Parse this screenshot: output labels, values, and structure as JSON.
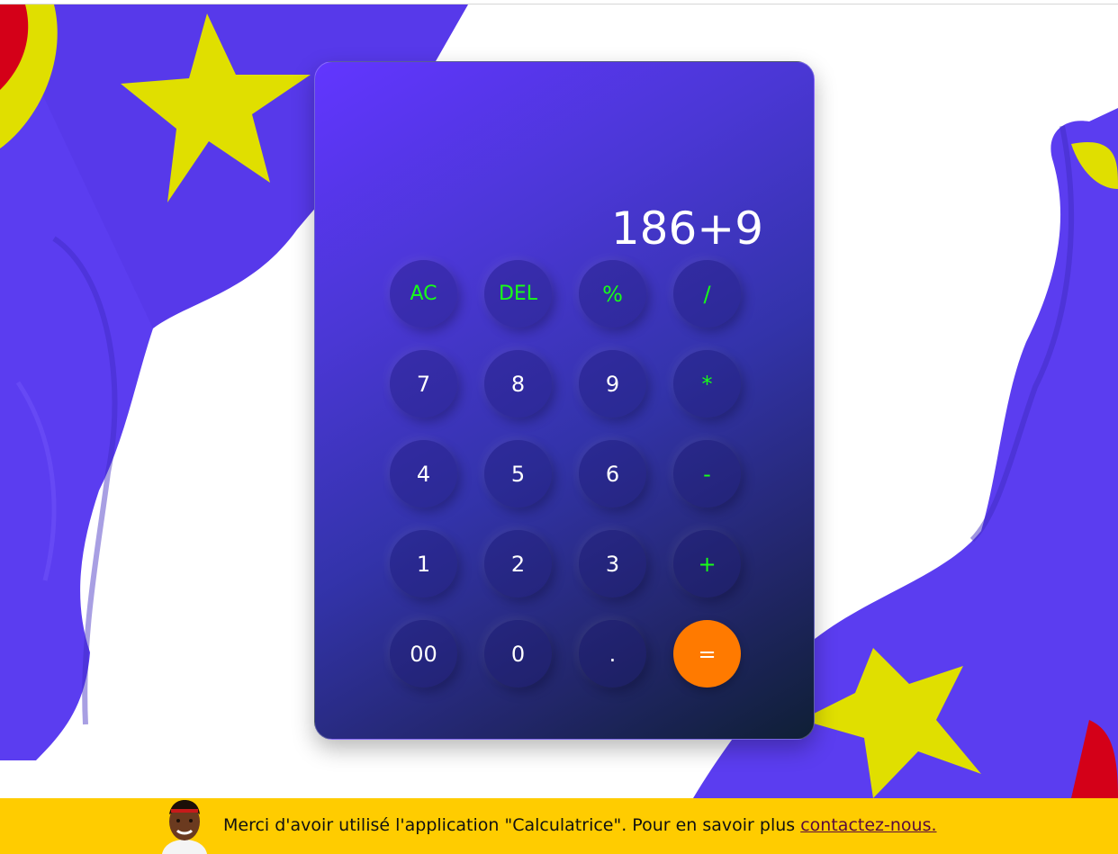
{
  "display": {
    "value": "186+9"
  },
  "keypad": {
    "rows": [
      [
        {
          "label": "AC",
          "kind": "fn",
          "name": "all-clear-button"
        },
        {
          "label": "DEL",
          "kind": "fn",
          "name": "delete-button"
        },
        {
          "label": "%",
          "kind": "op",
          "name": "percent-button"
        },
        {
          "label": "/",
          "kind": "op",
          "name": "divide-button"
        }
      ],
      [
        {
          "label": "7",
          "kind": "num",
          "name": "digit-7-button"
        },
        {
          "label": "8",
          "kind": "num",
          "name": "digit-8-button"
        },
        {
          "label": "9",
          "kind": "num",
          "name": "digit-9-button"
        },
        {
          "label": "*",
          "kind": "op",
          "name": "multiply-button"
        }
      ],
      [
        {
          "label": "4",
          "kind": "num",
          "name": "digit-4-button"
        },
        {
          "label": "5",
          "kind": "num",
          "name": "digit-5-button"
        },
        {
          "label": "6",
          "kind": "num",
          "name": "digit-6-button"
        },
        {
          "label": "-",
          "kind": "op",
          "name": "subtract-button"
        }
      ],
      [
        {
          "label": "1",
          "kind": "num",
          "name": "digit-1-button"
        },
        {
          "label": "2",
          "kind": "num",
          "name": "digit-2-button"
        },
        {
          "label": "3",
          "kind": "num",
          "name": "digit-3-button"
        },
        {
          "label": "+",
          "kind": "op",
          "name": "add-button"
        }
      ],
      [
        {
          "label": "00",
          "kind": "num",
          "name": "double-zero-button"
        },
        {
          "label": "0",
          "kind": "num",
          "name": "digit-0-button"
        },
        {
          "label": ".",
          "kind": "num",
          "name": "decimal-button"
        },
        {
          "label": "=",
          "kind": "eq",
          "name": "equals-button"
        }
      ]
    ]
  },
  "footer": {
    "message": "Merci d'avoir utilisé l'application \"Calculatrice\". Pour en savoir plus ",
    "link_label": "contactez-nous."
  },
  "colors": {
    "operator_text": "#17ff17",
    "equals_button": "#ff7a00",
    "banner": "#ffcc00",
    "flag_blue": "#5b3df0",
    "flag_yellow": "#e0df00",
    "flag_red": "#d40018"
  }
}
